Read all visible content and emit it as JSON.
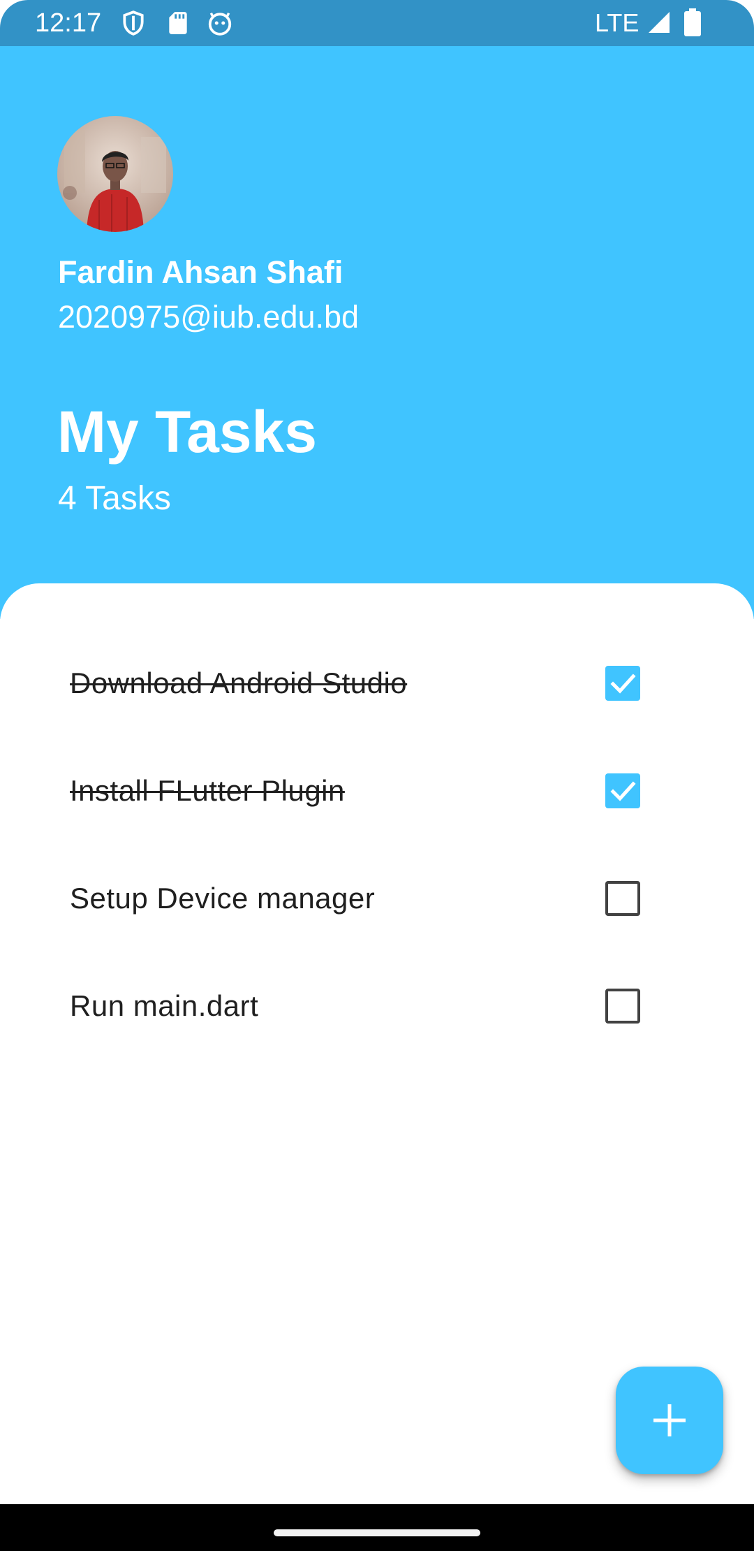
{
  "status_bar": {
    "time": "12:17",
    "network": "LTE",
    "icons": [
      "shield-icon",
      "sd-card-icon",
      "bot-icon",
      "signal-icon",
      "battery-icon"
    ]
  },
  "header": {
    "user_name": "Fardin Ahsan Shafi",
    "user_email": "2020975@iub.edu.bd",
    "title": "My Tasks",
    "task_count": "4 Tasks"
  },
  "tasks": [
    {
      "label": "Download Android Studio",
      "done": true
    },
    {
      "label": "Install FLutter Plugin",
      "done": true
    },
    {
      "label": "Setup Device manager",
      "done": false
    },
    {
      "label": "Run main.dart",
      "done": false
    }
  ],
  "fab": {
    "icon": "plus-icon"
  },
  "colors": {
    "accent": "#40C4FF",
    "status_bar": "#3292C6",
    "text": "#1F1F1F",
    "checkbox_border": "#424242"
  }
}
